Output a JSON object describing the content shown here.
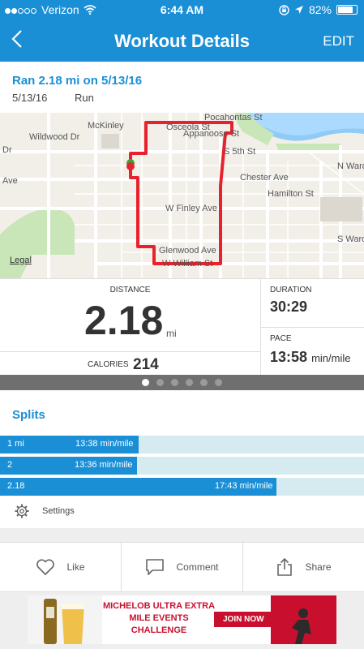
{
  "status_bar": {
    "carrier": "Verizon",
    "time": "6:44 AM",
    "battery_percent": "82%",
    "battery_level": 0.82,
    "signal_bars_filled": 2,
    "signal_bars_total": 5
  },
  "nav": {
    "back_icon": "chevron-left-icon",
    "title": "Workout Details",
    "edit_label": "EDIT"
  },
  "summary": {
    "headline": "Ran 2.18 mi on 5/13/16",
    "date": "5/13/16",
    "activity_type": "Run"
  },
  "map": {
    "legal_label": "Legal",
    "street_labels": {
      "wildwood": "Wildwood Dr",
      "dr_left": "Dr",
      "ave_left": "Ave",
      "mckinley": "McKinley",
      "osceola": "Osceola St",
      "appanoose": "Appanoose St",
      "pocahontas": "Pocahontas St",
      "s_fifth": "S 5th St",
      "chester": "Chester Ave",
      "hamilton": "Hamilton St",
      "n_ward": "N Ward St",
      "s_ward": "S Ward St",
      "w_finley": "W Finley Ave",
      "glenwood": "Glenwood Ave",
      "w_william": "W William St"
    },
    "route_color": "#e8222c",
    "water_color": "#aadaff",
    "park_color": "#c8e6b8"
  },
  "stats": {
    "distance_label": "DISTANCE",
    "distance_value": "2.18",
    "distance_unit": "mi",
    "calories_label": "CALORIES",
    "calories_value": "214",
    "duration_label": "DURATION",
    "duration_value": "30:29",
    "pace_label": "PACE",
    "pace_value": "13:58",
    "pace_unit": "min/mile"
  },
  "pager": {
    "pages": 6,
    "active_index": 0
  },
  "splits": {
    "title": "Splits",
    "rows": [
      {
        "label": "1 mi",
        "pace": "13:38 min/mile",
        "fraction": 0.38
      },
      {
        "label": "2",
        "pace": "13:36 min/mile",
        "fraction": 0.376
      },
      {
        "label": "2.18",
        "pace": "17:43 min/mile",
        "fraction": 0.76
      }
    ],
    "settings_label": "Settings"
  },
  "actions": {
    "like_label": "Like",
    "comment_label": "Comment",
    "share_label": "Share"
  },
  "ad": {
    "headline": "MICHELOB ULTRA EXTRA MILE EVENTS CHALLENGE",
    "cta": "JOIN NOW"
  },
  "colors": {
    "accent": "#1a8fd6",
    "split_track": "#d6ebef",
    "ad_red": "#c8102e"
  }
}
